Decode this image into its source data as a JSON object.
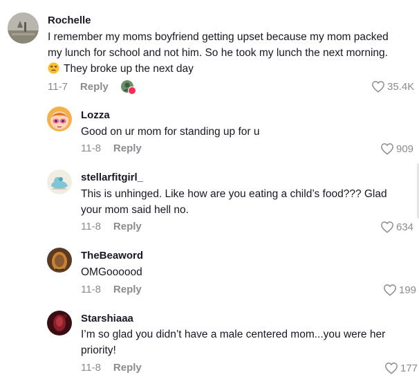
{
  "comments": [
    {
      "username": "Rochelle",
      "text_lines": [
        "I remember my moms boyfriend getting upset because my mom packed",
        "my lunch for school and not him. So he took my lunch the next morning."
      ],
      "emoji_icon": "unamused-face-icon",
      "text_last": "They broke up the next day",
      "date": "11-7",
      "reply_label": "Reply",
      "likes": "35.4K"
    },
    {
      "username": "Lozza",
      "text_lines": [
        "Good on ur mom for standing up for u"
      ],
      "date": "11-8",
      "reply_label": "Reply",
      "likes": "909"
    },
    {
      "username": "stellarfitgirl_",
      "text_lines": [
        "This is unhinged. Like how are you eating a child’s food??? Glad",
        "your mom said hell no."
      ],
      "date": "11-8",
      "reply_label": "Reply",
      "likes": "634"
    },
    {
      "username": "TheBeaword",
      "text_lines": [
        "OMGoooood"
      ],
      "date": "11-8",
      "reply_label": "Reply",
      "likes": "199"
    },
    {
      "username": "Starshiaaa",
      "text_lines": [
        "I’m so glad you didn’t have a male centered mom...you were her",
        "priority!"
      ],
      "date": "11-8",
      "reply_label": "Reply",
      "likes": "177"
    }
  ],
  "colors": {
    "muted": "#8a8b91",
    "text": "#161823",
    "accent": "#fe2c55"
  }
}
